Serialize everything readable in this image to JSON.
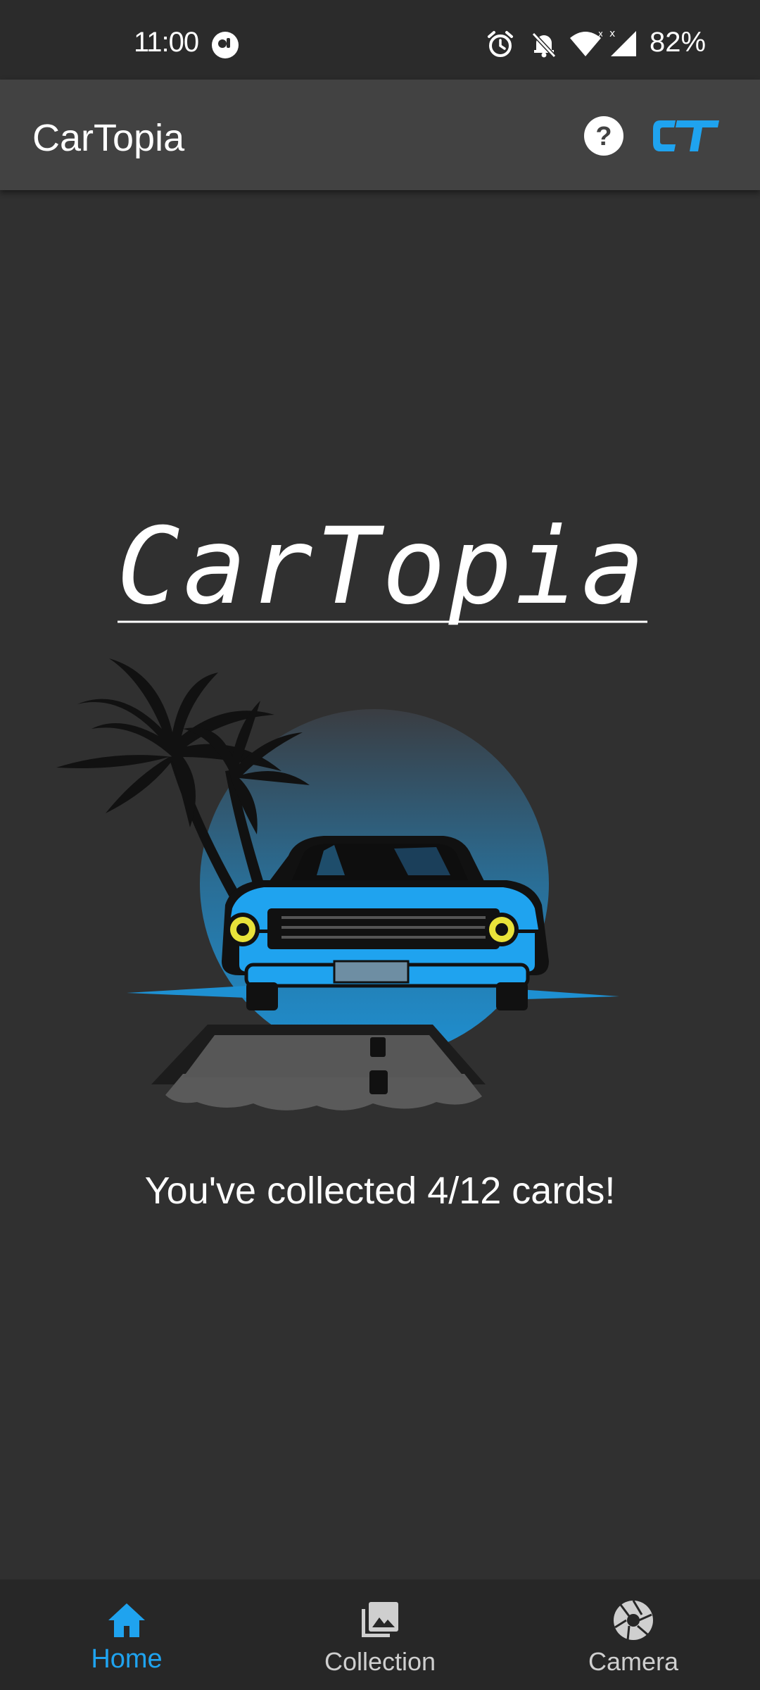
{
  "status_bar": {
    "time": "11:00",
    "battery": "82%",
    "icons": [
      "notification-app-icon",
      "alarm-icon",
      "bell-off-icon",
      "wifi-icon",
      "signal-icon"
    ]
  },
  "app_bar": {
    "title": "CarTopia",
    "help_icon": "help-circle-icon",
    "logo_text": "CT"
  },
  "main": {
    "hero_title": "CarTopia",
    "collected_text": "You've collected 4/12 cards!",
    "collected": 4,
    "total": 12
  },
  "bottom_nav": {
    "items": [
      {
        "label": "Home",
        "icon": "home-icon",
        "active": true
      },
      {
        "label": "Collection",
        "icon": "photo-library-icon",
        "active": false
      },
      {
        "label": "Camera",
        "icon": "camera-shutter-icon",
        "active": false
      }
    ]
  },
  "colors": {
    "accent": "#1fa3ef",
    "background": "#303030",
    "app_bar": "#424242",
    "nav_bar": "#272727"
  }
}
